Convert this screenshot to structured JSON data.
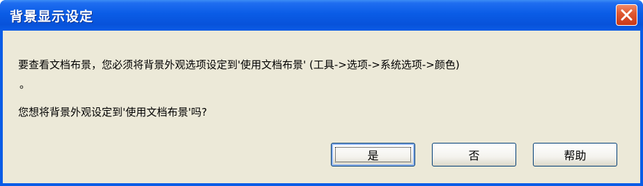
{
  "window": {
    "title": "背景显示设定"
  },
  "dialog": {
    "message_line1": "要查看文档布景，您必须将背景外观选项设定到'使用文档布景' (工具->选项->系统选项->颜色)",
    "message_line2": "。",
    "question": "您想将背景外观设定到'使用文档布景'吗?"
  },
  "buttons": {
    "yes_label": "是",
    "no_label": "否",
    "help_label": "帮助"
  },
  "icons": {
    "close": "close-icon"
  },
  "colors": {
    "titlebar": "#0a5ce6",
    "client": "#ece9d8",
    "close_button": "#e05a32"
  }
}
